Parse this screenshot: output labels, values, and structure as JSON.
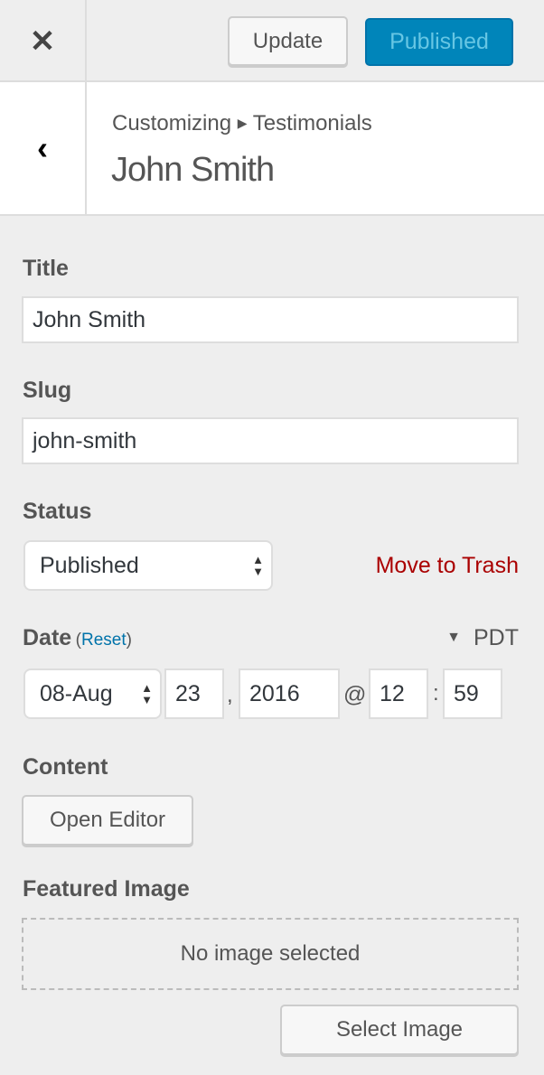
{
  "topbar": {
    "close_icon": "close-icon",
    "update_label": "Update",
    "published_label": "Published",
    "accent": "#0085ba"
  },
  "header": {
    "breadcrumb_root": "Customizing",
    "breadcrumb_section": "Testimonials",
    "title": "John Smith"
  },
  "form": {
    "title_label": "Title",
    "title_value": "John Smith",
    "slug_label": "Slug",
    "slug_value": "john-smith",
    "status_label": "Status",
    "status_value": "Published",
    "trash_label": "Move to Trash",
    "trash_color": "#a00",
    "date_label": "Date",
    "reset_open": "(",
    "reset_label": "Reset",
    "reset_close": ")",
    "timezone": "PDT",
    "month": "08-Aug",
    "day": "23",
    "comma": ",",
    "year": "2016",
    "at": "@",
    "hour": "12",
    "colon": ":",
    "minute": "59",
    "content_label": "Content",
    "open_editor": "Open Editor",
    "featured_label": "Featured Image",
    "no_image": "No image selected",
    "select_image": "Select Image"
  }
}
